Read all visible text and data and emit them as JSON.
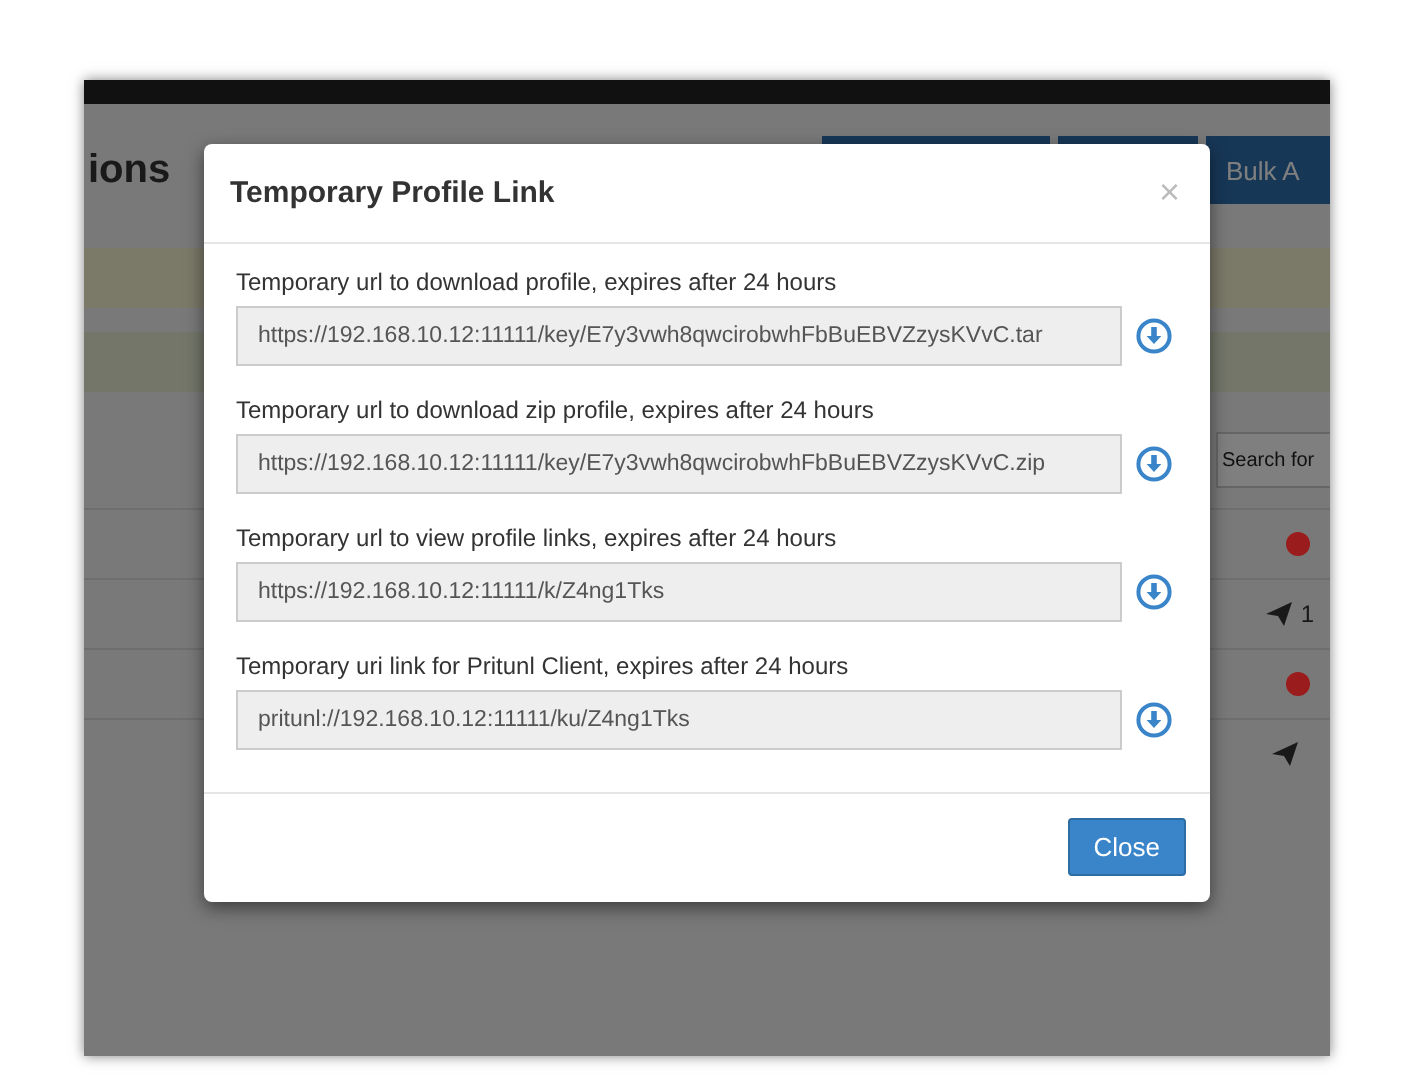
{
  "page": {
    "title": "ions",
    "buttons": [
      {
        "kind": "blank"
      },
      {
        "kind": "blank"
      },
      {
        "kind": "text",
        "label": "Bulk A"
      }
    ],
    "search": {
      "placeholder": "Search for"
    },
    "rows": [
      {
        "kind": "status",
        "color": "#9b1c1c"
      },
      {
        "kind": "count",
        "text": "1"
      },
      {
        "kind": "status",
        "color": "#9b1c1c"
      },
      {
        "kind": "count"
      }
    ]
  },
  "modal": {
    "title": "Temporary Profile Link",
    "close_symbol": "×",
    "links": [
      {
        "label": "Temporary url to download profile, expires after 24 hours",
        "value": "https://192.168.10.12:11111/key/E7y3vwh8qwcirobwhFbBuEBVZzysKVvC.tar"
      },
      {
        "label": "Temporary url to download zip profile, expires after 24 hours",
        "value": "https://192.168.10.12:11111/key/E7y3vwh8qwcirobwhFbBuEBVZzysKVvC.zip"
      },
      {
        "label": "Temporary url to view profile links, expires after 24 hours",
        "value": "https://192.168.10.12:11111/k/Z4ng1Tks"
      },
      {
        "label": "Temporary uri link for Pritunl Client, expires after 24 hours",
        "value": "pritunl://192.168.10.12:11111/ku/Z4ng1Tks"
      }
    ],
    "button": "Close"
  }
}
